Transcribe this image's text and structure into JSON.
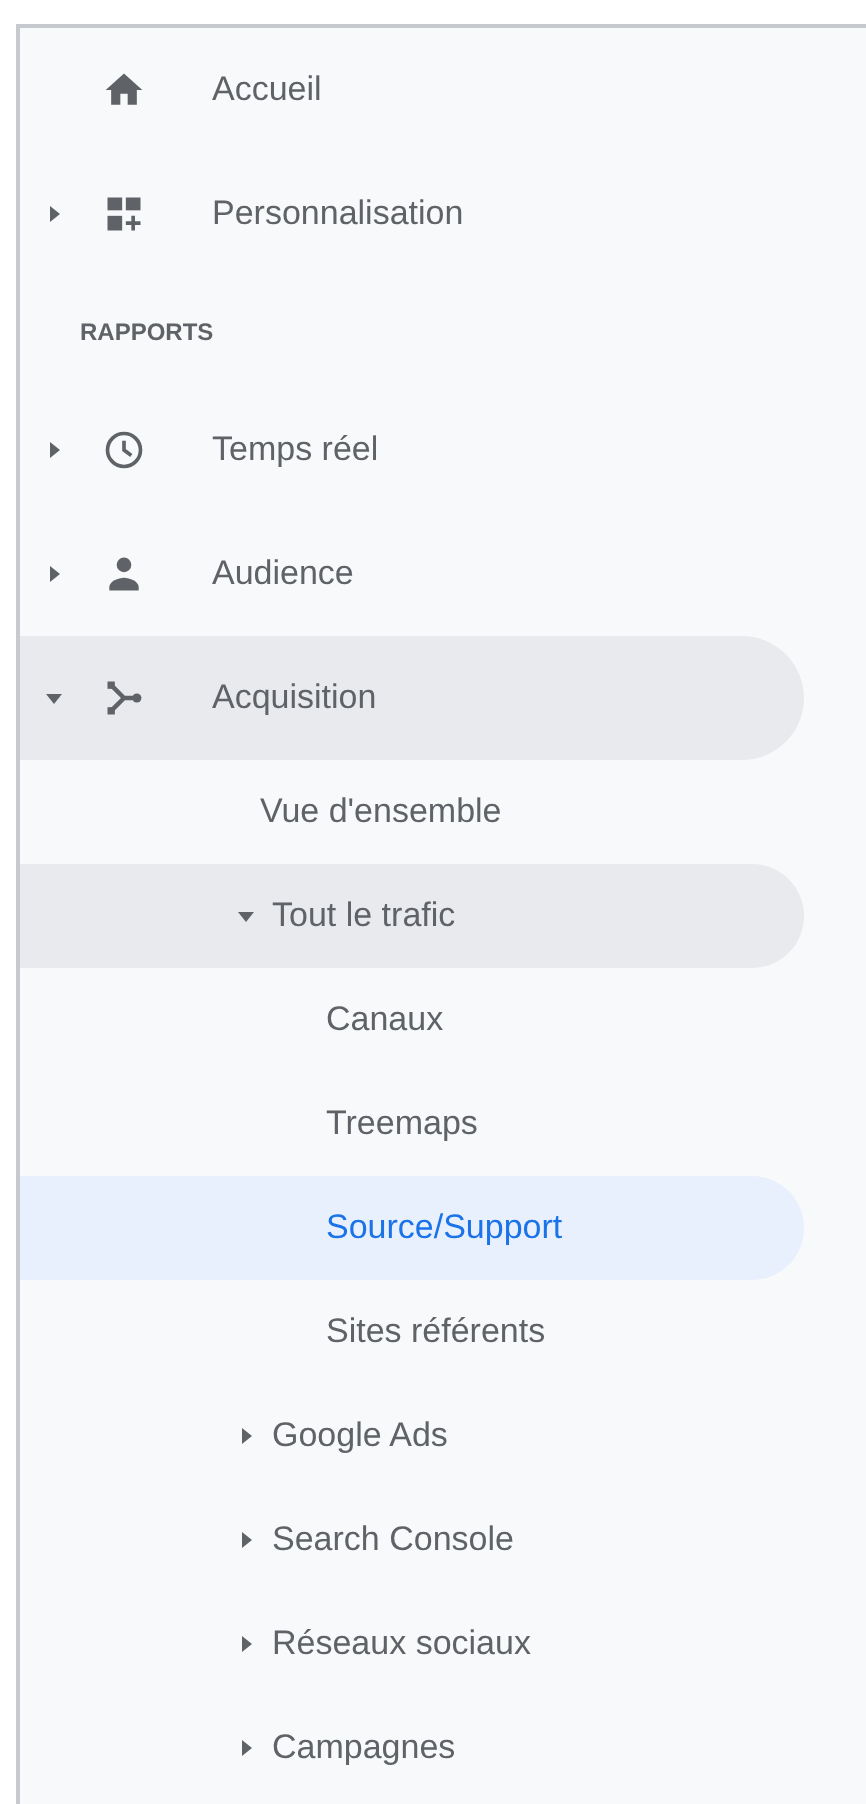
{
  "nav": {
    "items": [
      {
        "label": "Accueil",
        "kind": "home",
        "selected": false
      },
      {
        "label": "Personnalisation",
        "kind": "dashboard",
        "expanded": false,
        "selected": false
      },
      {
        "label": "RAPPORTS",
        "kind": "section"
      },
      {
        "label": "Temps réel",
        "kind": "clock",
        "expanded": false,
        "selected": false
      },
      {
        "label": "Audience",
        "kind": "person",
        "expanded": false,
        "selected": false
      },
      {
        "label": "Acquisition",
        "kind": "acquisition",
        "expanded": true,
        "selected": false,
        "children": [
          {
            "label": "Vue d'ensemble",
            "selected": false
          },
          {
            "label": "Tout le trafic",
            "expanded": true,
            "selected": false,
            "children": [
              {
                "label": "Canaux",
                "selected": false
              },
              {
                "label": "Treemaps",
                "selected": false
              },
              {
                "label": "Source/Support",
                "selected": true
              },
              {
                "label": "Sites référents",
                "selected": false
              }
            ]
          },
          {
            "label": "Google Ads",
            "expanded": false,
            "selected": false
          },
          {
            "label": "Search Console",
            "expanded": false,
            "selected": false
          },
          {
            "label": "Réseaux sociaux",
            "expanded": false,
            "selected": false
          },
          {
            "label": "Campagnes",
            "expanded": false,
            "selected": false
          }
        ]
      }
    ]
  }
}
